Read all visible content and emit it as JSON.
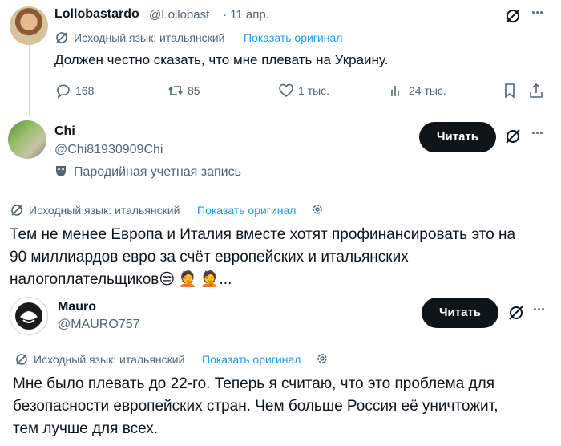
{
  "tweet1": {
    "display_name": "Lollobastardo",
    "handle": "@Lollobast",
    "date": "· 11 апр.",
    "translation_label": "Исходный язык: итальянский",
    "show_original": "Показать оригинал",
    "text": "Должен честно сказать, что мне плевать на Украину.",
    "stats": {
      "replies": "168",
      "retweets": "85",
      "likes": "1 тыс.",
      "views": "24 тыс."
    },
    "more": "···"
  },
  "tweet2": {
    "display_name": "Chi",
    "handle": "@Chi81930909Chi",
    "parody_label": "Пародийная учетная запись",
    "follow_button": "Читать",
    "more": "···",
    "translation_label": "Исходный язык: итальянский",
    "show_original": "Показать оригинал",
    "text_line1": "Тем не менее Европа и Италия вместе хотят профинансировать это на",
    "text_line2": "90 миллиардов евро за счёт европейских и итальянских",
    "text_line3": "налогоплательщиков",
    "text_emoji": "😒🤦🤦...",
    "emoji_1": "😒",
    "emoji_2": "🤦",
    "emoji_3": "🤦",
    "ellipsis": "..."
  },
  "tweet3": {
    "display_name": "Mauro",
    "handle": "@MAURO757",
    "follow_button": "Читать",
    "more": "···",
    "translation_label": "Исходный язык: итальянский",
    "show_original": "Показать оригинал",
    "text_line1": "Мне было плевать до 22-го. Теперь я считаю, что это проблема для",
    "text_line2": "безопасности европейских стран. Чем больше Россия её уничтожит,",
    "text_line3": "тем лучше для всех."
  },
  "colors": {
    "accent": "#1d9bf0",
    "text": "#0f1419",
    "muted": "#536471",
    "button": "#0f1419"
  }
}
